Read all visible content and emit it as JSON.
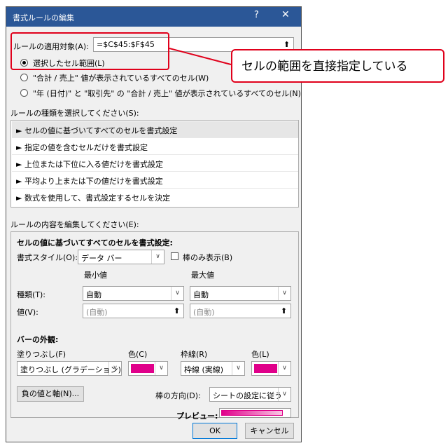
{
  "dialog": {
    "title": "書式ルールの編集",
    "help": "?",
    "close": "✕"
  },
  "applies_to": {
    "label": "ルールの適用対象(A):",
    "value": "=$C$45:$F$45",
    "option_selected": "選択したセル範囲(L)",
    "option_total_sales": "\"合計 / 売上\" 値が表示されているすべてのセル(W)",
    "option_year_customer": "\"年 (日付)\" と \"取引先\" の \"合計 / 売上\" 値が表示されているすべてのセル(N)",
    "selected_option_index": 0
  },
  "rule_type": {
    "label": "ルールの種類を選択してください(S):",
    "items": [
      "► セルの値に基づいてすべてのセルを書式設定",
      "► 指定の値を含むセルだけを書式設定",
      "► 上位または下位に入る値だけを書式設定",
      "► 平均より上または下の値だけを書式設定",
      "► 数式を使用して、書式設定するセルを決定"
    ],
    "selected_index": 0
  },
  "rule_edit": {
    "label": "ルールの内容を編集してください(E):",
    "heading": "セルの値に基づいてすべてのセルを書式設定:",
    "format_style_label": "書式スタイル(O):",
    "format_style_value": "データ バー",
    "bar_only_label": "棒のみ表示(B)",
    "min_header": "最小値",
    "max_header": "最大値",
    "type_label": "種類(T):",
    "min_type": "自動",
    "max_type": "自動",
    "value_label": "値(V):",
    "min_value": "(自動)",
    "max_value": "(自動)"
  },
  "bar_appearance": {
    "heading": "バーの外観:",
    "fill_label": "塗りつぶし(F)",
    "fill_value": "塗りつぶし (グラデーション)",
    "fill_color_label": "色(C)",
    "border_label": "枠線(R)",
    "border_value": "枠線 (実線)",
    "border_color_label": "色(L)",
    "bar_color": "#e0008a",
    "negative_button": "負の値と軸(N)...",
    "direction_label": "棒の方向(D):",
    "direction_value": "シートの設定に従う",
    "preview_label": "プレビュー:"
  },
  "buttons": {
    "ok": "OK",
    "cancel": "キャンセル"
  },
  "callout": {
    "text": "セルの範囲を直接指定している",
    "color": "#e0001b"
  }
}
